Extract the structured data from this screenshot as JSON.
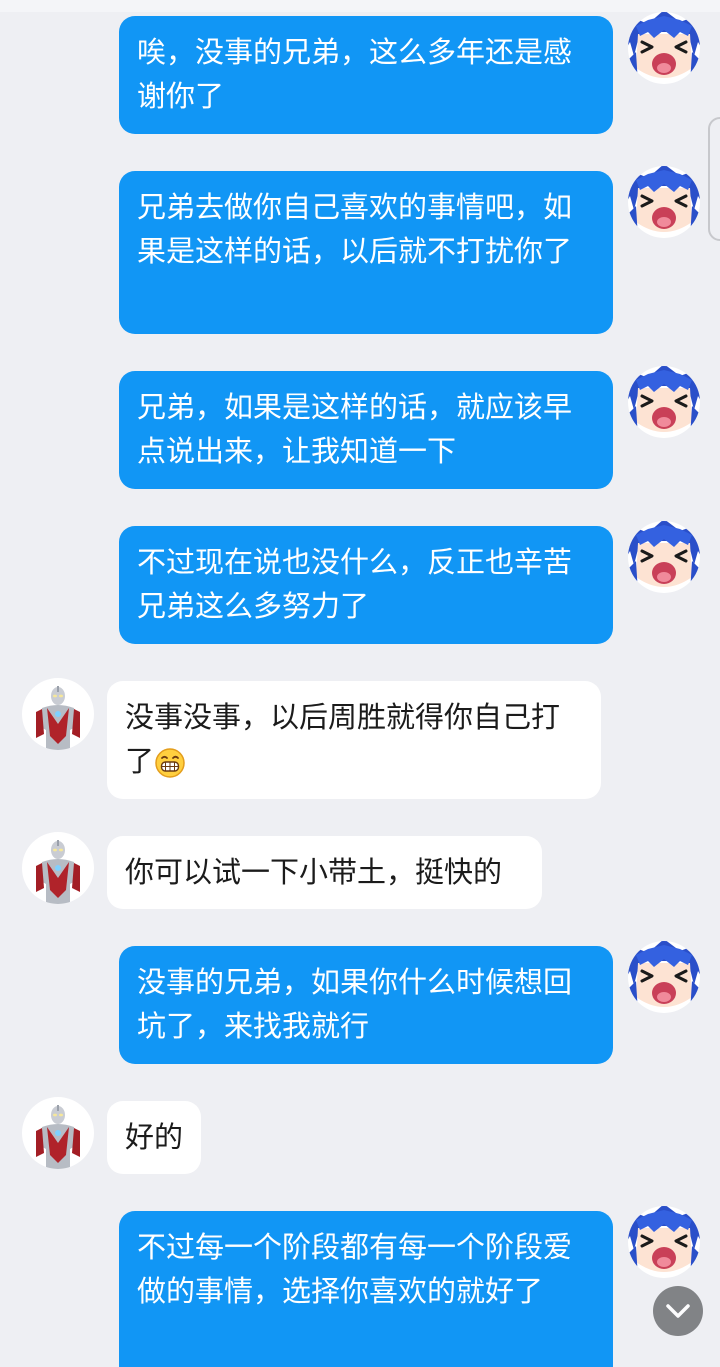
{
  "messages": [
    {
      "side": "out",
      "text": "唉，没事的兄弟，这么多年还是感谢你了"
    },
    {
      "side": "out",
      "text": "兄弟去做你自己喜欢的事情吧，如果是这样的话，以后就不打扰你了"
    },
    {
      "side": "out",
      "text": "兄弟，如果是这样的话，就应该早点说出来，让我知道一下"
    },
    {
      "side": "out",
      "text": "不过现在说也没什么，反正也辛苦兄弟这么多努力了"
    },
    {
      "side": "in",
      "text": "没事没事，以后周胜就得你自己打了",
      "emoji": "grin-emoji"
    },
    {
      "side": "in",
      "text": "你可以试一下小带土，挺快的"
    },
    {
      "side": "out",
      "text": "没事的兄弟，如果你什么时候想回坑了，来找我就行"
    },
    {
      "side": "in",
      "text": "好的"
    },
    {
      "side": "out",
      "text": "不过每一个阶段都有每一个阶段爱做的事情，选择你喜欢的就好了"
    }
  ],
  "colors": {
    "background": "#eeeff3",
    "outgoing_bubble": "#1196f5",
    "incoming_bubble": "#ffffff"
  },
  "icons": {
    "my_avatar": "anime-girl-avatar",
    "friend_avatar": "ultraman-avatar",
    "scroll_button": "chevron-down-icon"
  }
}
